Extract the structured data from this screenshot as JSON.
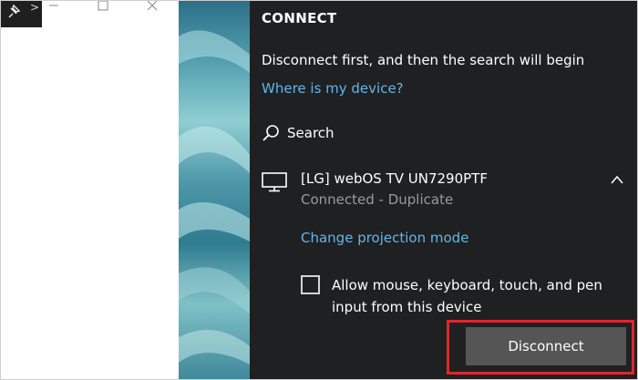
{
  "panel": {
    "title": "CONNECT",
    "message": "Disconnect first, and then the search will begin",
    "where_link": "Where is my device?",
    "search_label": "Search"
  },
  "device": {
    "name": "[LG] webOS TV UN7290PTF",
    "status": "Connected - Duplicate",
    "change_mode_link": "Change projection mode",
    "allow_input_label": "Allow mouse, keyboard, touch, and pen input from this device",
    "allow_input_checked": false,
    "disconnect_label": "Disconnect"
  },
  "icons": {
    "pin": "pin-icon",
    "minimize": "minimize-icon",
    "maximize": "maximize-icon",
    "close": "close-icon",
    "search": "search-icon",
    "monitor": "monitor-icon",
    "collapse": "chevron-up-icon"
  },
  "colors": {
    "panel_background": "#1f2021",
    "link": "#61b6ec",
    "status_text": "#9a9a9a",
    "button_background": "#555555",
    "highlight_border": "#e0262f"
  }
}
